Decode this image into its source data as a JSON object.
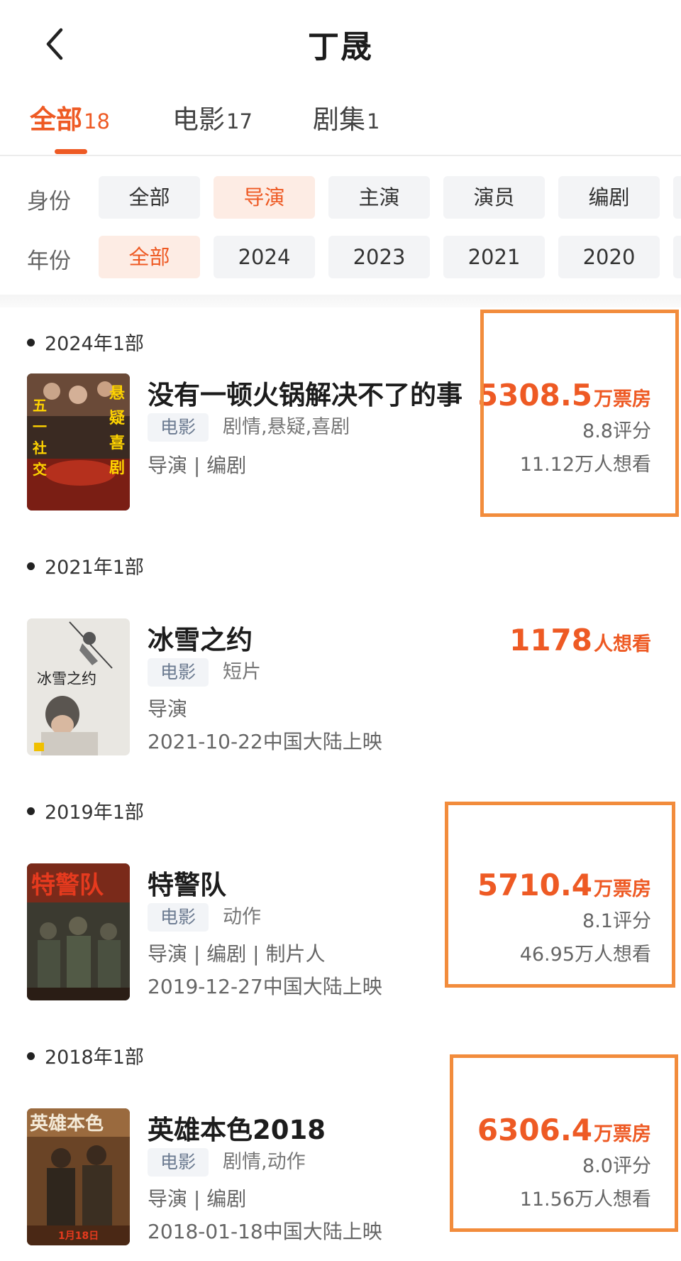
{
  "header": {
    "title": "丁晟"
  },
  "tabs": [
    {
      "label": "全部",
      "count": "18",
      "active": true
    },
    {
      "label": "电影",
      "count": "17",
      "active": false
    },
    {
      "label": "剧集",
      "count": "1",
      "active": false
    }
  ],
  "filters": {
    "role": {
      "label": "身份",
      "options": [
        "全部",
        "导演",
        "主演",
        "演员",
        "编剧"
      ],
      "selected": "导演"
    },
    "year": {
      "label": "年份",
      "options": [
        "全部",
        "2024",
        "2023",
        "2021",
        "2020"
      ],
      "selected": "全部"
    }
  },
  "groups": [
    {
      "heading": "2024年1部",
      "movie": {
        "title": "没有一顿火锅解决不了的事",
        "type": "电影",
        "genres": "剧情,悬疑,喜剧",
        "roles": "导演 | 编剧",
        "release": "",
        "primary_value": "5308.5",
        "primary_unit": "万票房",
        "score": "8.8评分",
        "want": "11.12万人想看",
        "poster_icon": "poster-hotpot-movie"
      }
    },
    {
      "heading": "2021年1部",
      "movie": {
        "title": "冰雪之约",
        "type": "电影",
        "genres": "短片",
        "roles": "导演",
        "release": "2021-10-22中国大陆上映",
        "primary_value": "1178",
        "primary_unit": "人想看",
        "score": "",
        "want": "",
        "poster_icon": "poster-ice-snow"
      }
    },
    {
      "heading": "2019年1部",
      "movie": {
        "title": "特警队",
        "type": "电影",
        "genres": "动作",
        "roles": "导演 | 编剧 | 制片人",
        "release": "2019-12-27中国大陆上映",
        "primary_value": "5710.4",
        "primary_unit": "万票房",
        "score": "8.1评分",
        "want": "46.95万人想看",
        "poster_icon": "poster-swat"
      }
    },
    {
      "heading": "2018年1部",
      "movie": {
        "title": "英雄本色2018",
        "type": "电影",
        "genres": "剧情,动作",
        "roles": "导演 | 编剧",
        "release": "2018-01-18中国大陆上映",
        "primary_value": "6306.4",
        "primary_unit": "万票房",
        "score": "8.0评分",
        "want": "11.56万人想看",
        "poster_icon": "poster-hero"
      }
    }
  ],
  "colors": {
    "accent": "#ee5a24",
    "highlight_box": "#f28c3c",
    "chip_bg": "#f3f4f6",
    "chip_active_bg": "#fdece4"
  }
}
